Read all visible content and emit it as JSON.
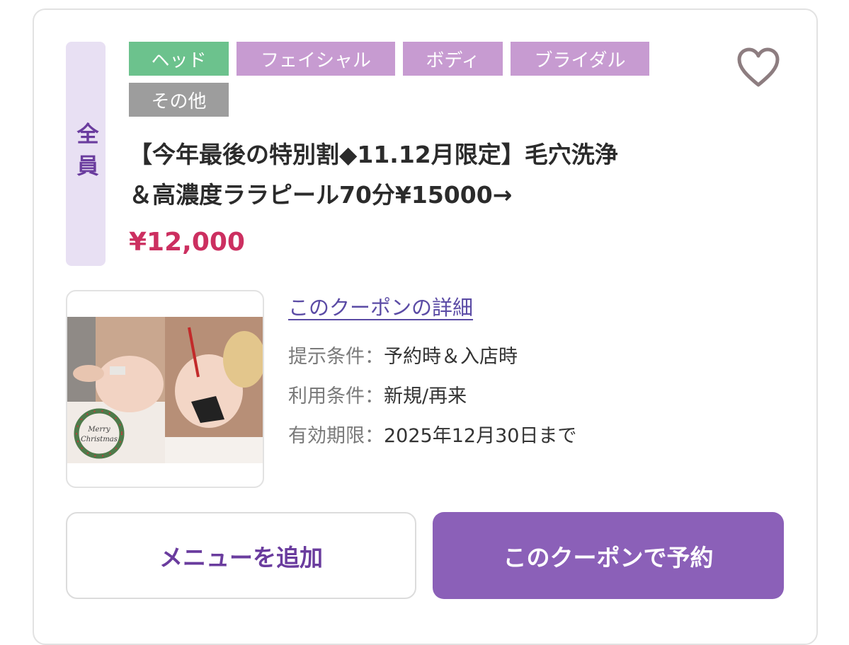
{
  "coupon": {
    "target_label": "全員",
    "tags": [
      {
        "label": "ヘッド",
        "color": "#6cc28d"
      },
      {
        "label": "フェイシャル",
        "color": "#c79bd1"
      },
      {
        "label": "ボディ",
        "color": "#c79bd1"
      },
      {
        "label": "ブライダル",
        "color": "#c79bd1"
      },
      {
        "label": "その他",
        "color": "#9d9d9d"
      }
    ],
    "title_line1": "【今年最後の特別割◆11.12月限定】毛穴洗浄",
    "title_line2": "＆高濃度ララピール70分¥15000→",
    "price": "¥12,000",
    "photo_caption": "Merry Christmas",
    "detail_link": "このクーポンの詳細",
    "conditions": [
      {
        "label": "提示条件：",
        "value": "予約時＆入店時"
      },
      {
        "label": "利用条件：",
        "value": "新規/再来"
      },
      {
        "label": "有効期限：",
        "value": "2025年12月30日まで"
      }
    ],
    "favorite_icon": "heart-outline-icon",
    "buttons": {
      "add_menu": "メニューを追加",
      "reserve": "このクーポンで予約"
    },
    "colors": {
      "accent_purple": "#8b60b8",
      "price_red": "#cc2f60",
      "link_purple": "#5b4ba5"
    }
  }
}
